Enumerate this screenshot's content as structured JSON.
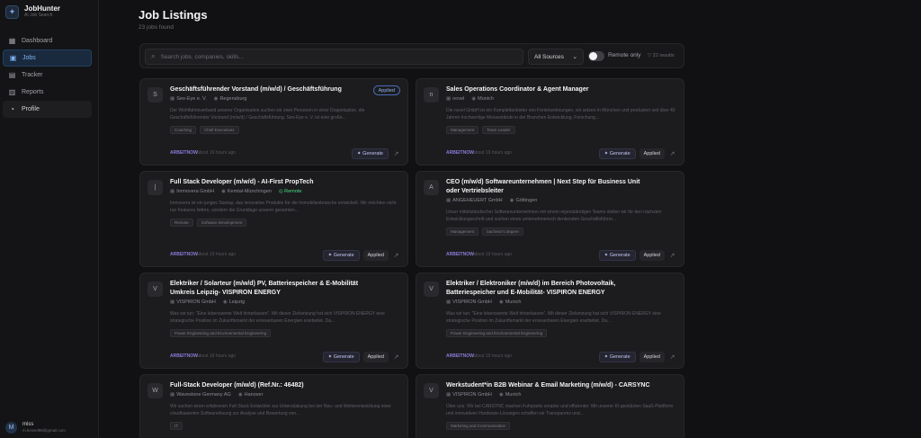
{
  "app": {
    "name": "JobHunter",
    "subtitle": "AI Job Search"
  },
  "nav": [
    {
      "label": "Dashboard",
      "icon": "dashboard-icon",
      "glyph": "▦",
      "state": ""
    },
    {
      "label": "Jobs",
      "icon": "briefcase-icon",
      "glyph": "▣",
      "state": "active"
    },
    {
      "label": "Tracker",
      "icon": "kanban-icon",
      "glyph": "▤",
      "state": ""
    },
    {
      "label": "Reports",
      "icon": "chart-icon",
      "glyph": "▥",
      "state": ""
    },
    {
      "label": "Profile",
      "icon": "user-icon",
      "glyph": "◔",
      "state": "hover"
    }
  ],
  "user": {
    "initial": "M",
    "name": "miss",
    "email": "m.kessel98@gmail.com"
  },
  "page": {
    "title": "Job Listings",
    "subtitle": "23 jobs found"
  },
  "filters": {
    "search_placeholder": "Search jobs, companies, skills...",
    "source_value": "All Sources",
    "remote_label": "Remote only",
    "count_label": "22 results"
  },
  "jobs": [
    {
      "logo": "S",
      "title": "Geschäftsführender Vorstand (m/w/d) / Geschäftsführung",
      "company": "Seo-Eye e. V.",
      "location": "Regensburg",
      "remote": "",
      "applied_badge": "Applied",
      "description": "Der Wohlfahrtsverband unserer Organisation suchen wir zwei Personen in einer Doppelspitze, die Geschäftsführender Vorstand (m/w/d) / Geschäftsführung. Seo-Eye e. V. ist eine große...",
      "tags": [
        "Coaching",
        "Chief Executives"
      ],
      "source": "ARBEITNOW",
      "time": "about 19 hours ago",
      "generate_label": "Generate",
      "applied_label": ""
    },
    {
      "logo": "n",
      "title": "Sales Operations Coordinator & Agent Manager",
      "company": "novel",
      "location": "Munich",
      "remote": "",
      "applied_badge": "",
      "description": "Die novel GmbH ist ein Komplettanbieter von Ferienwohnungen, wir setzen in München und produziert seit über 40 Jahren hochwertige Messestände in der Branchen Entwicklung, Forschung...",
      "tags": [
        "Management",
        "Team Leader"
      ],
      "source": "ARBEITNOW",
      "time": "about 19 hours ago",
      "generate_label": "Generate",
      "applied_label": "Applied"
    },
    {
      "logo": "|",
      "title": "Full Stack Developer (m/w/d) - AI-First PropTech",
      "company": "Immovera GmbH",
      "location": "Kemtal-Münchingen",
      "remote": "Remote",
      "applied_badge": "",
      "description": "Immovera ist ein junges Startup, das innovative Produkte für die Immobilienbranche entwickelt. Wir möchten nicht nur Features liefern, sondern die Grundlage unserer gesamten...",
      "tags": [
        "Remote",
        "Software Development"
      ],
      "source": "ARBEITNOW",
      "time": "about 19 hours ago",
      "generate_label": "Generate",
      "applied_label": "Applied"
    },
    {
      "logo": "A",
      "title": "CEO (m/w/d) Softwareunternehmen | Next Step für Business Unit oder Vertriebsleiter",
      "company": "ANGEHEUERT GmbH",
      "location": "Göttingen",
      "remote": "",
      "applied_badge": "",
      "description": "Unser mittelständischer Softwareunternehmen mit einem eigenständigen Teams stellen wir für den nächsten Entwicklungsschritt und suchen einen unternehmerisch denkenden Geschäftsführer...",
      "tags": [
        "Management",
        "bachelor's degree"
      ],
      "source": "ARBEITNOW",
      "time": "about 19 hours ago",
      "generate_label": "Generate",
      "applied_label": "Applied"
    },
    {
      "logo": "V",
      "title": "Elektriker / Solarteur (m/w/d) PV, Batteriespeicher & E-Mobilität Umkreis Leipzig- VISPIRON ENERGY",
      "company": "VISPIRON GmbH",
      "location": "Leipzig",
      "remote": "",
      "applied_badge": "",
      "description": "Was wir tun: \"Eine lebenswerte Welt hinterlassen\". Mit dieser Zielsetzung hat sich VISPIRON ENERGY eine strategische Position im Zukunftsmarkt der erneuerbaren Energien erarbeitet. Da...",
      "tags": [
        "Power Engineering and Environmental Engineering"
      ],
      "source": "ARBEITNOW",
      "time": "about 19 hours ago",
      "generate_label": "Generate",
      "applied_label": "Applied"
    },
    {
      "logo": "V",
      "title": "Elektriker / Elektroniker (m/w/d) im Bereich Photovoltaik, Batteriespeicher und E-Mobilität- VISPIRON ENERGY",
      "company": "VISPIRON GmbH",
      "location": "Munich",
      "remote": "",
      "applied_badge": "",
      "description": "Was wir tun: \"Eine lebenswerte Welt hinterlassen\". Mit dieser Zielsetzung hat sich VISPIRON ENERGY eine strategische Position im Zukunftsmarkt der erneuerbaren Energien erarbeitet. Da...",
      "tags": [
        "Power Engineering and Environmental Engineering"
      ],
      "source": "ARBEITNOW",
      "time": "about 19 hours ago",
      "generate_label": "Generate",
      "applied_label": "Applied"
    },
    {
      "logo": "W",
      "title": "Full-Stack Developer (m/w/d) (Ref.Nr.: 46482)",
      "company": "Wavestone Germany AG",
      "location": "Hanover",
      "remote": "",
      "applied_badge": "",
      "description": "Wir suchen einen erfahrenen Full-Stack Entwickler zur Unterstützung bei der Neu- und Weiterentwicklung einer cloudbasierten Softwarelösung zur Analyse und Bewertung von...",
      "tags": [
        "IT"
      ],
      "source": "",
      "time": "",
      "generate_label": "",
      "applied_label": ""
    },
    {
      "logo": "V",
      "title": "Werkstudent*in B2B Webinar & Email Marketing (m/w/d) - CARSYNC",
      "company": "VISPIRON GmbH",
      "location": "Munich",
      "remote": "",
      "applied_badge": "",
      "description": "Über uns: Wir bei CARSYNC machen Fuhrparks smarter und effizienter. Mit unserer KI-gestützten SaaS-Plattform und innovativen Hardware-Lösungen schaffen wir Transparenz und...",
      "tags": [
        "Marketing and Communication"
      ],
      "source": "",
      "time": "",
      "generate_label": "",
      "applied_label": ""
    }
  ]
}
